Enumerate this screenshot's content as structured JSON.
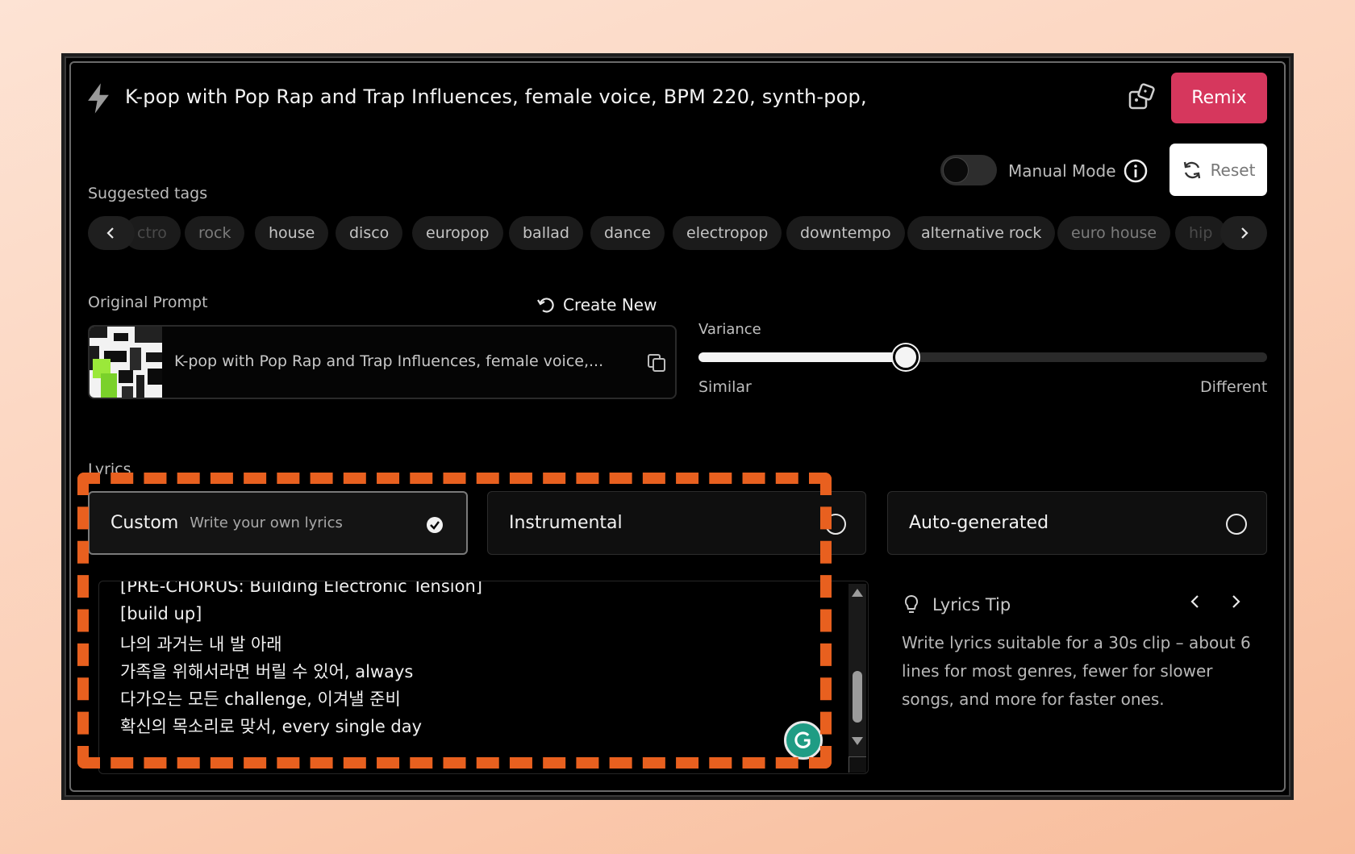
{
  "header": {
    "title": "K-pop with Pop Rap and Trap Influences, female voice, BPM 220,  synth-pop,",
    "remix_label": "Remix",
    "manual_mode_label": "Manual Mode",
    "manual_mode_on": false,
    "reset_label": "Reset"
  },
  "tags": {
    "label": "Suggested tags",
    "items": [
      "ctro",
      "rock",
      "house",
      "disco",
      "europop",
      "ballad",
      "dance",
      "electropop",
      "downtempo",
      "alternative rock",
      "euro house",
      "hip"
    ]
  },
  "original_prompt": {
    "label": "Original Prompt",
    "create_new_label": "Create New",
    "text": "K-pop with Pop Rap and Trap Influences, female voice,..."
  },
  "variance": {
    "label": "Variance",
    "min_label": "Similar",
    "max_label": "Different",
    "value": 0.365
  },
  "lyrics": {
    "label": "Lyrics",
    "options": [
      {
        "main": "Custom",
        "sub": "Write your own lyrics",
        "selected": true
      },
      {
        "main": "Instrumental",
        "sub": "",
        "selected": false
      },
      {
        "main": "Auto-generated",
        "sub": "",
        "selected": false
      }
    ],
    "lines": [
      "[PRE-CHORUS: Building Electronic Tension]",
      "[build up]",
      "나의 과거는 내 발 아래",
      "가족을 위해서라면 버릴 수 있어, always",
      "다가오는 모든 challenge, 이겨낼 준비",
      "확신의 목소리로 맞서, every single day"
    ]
  },
  "tip": {
    "title": "Lyrics Tip",
    "text": "Write lyrics suitable for a 30s clip – about 6 lines for most genres, fewer for slower songs, and more for faster ones."
  },
  "colors": {
    "accent": "#d6375d",
    "highlight": "#e8601f"
  }
}
